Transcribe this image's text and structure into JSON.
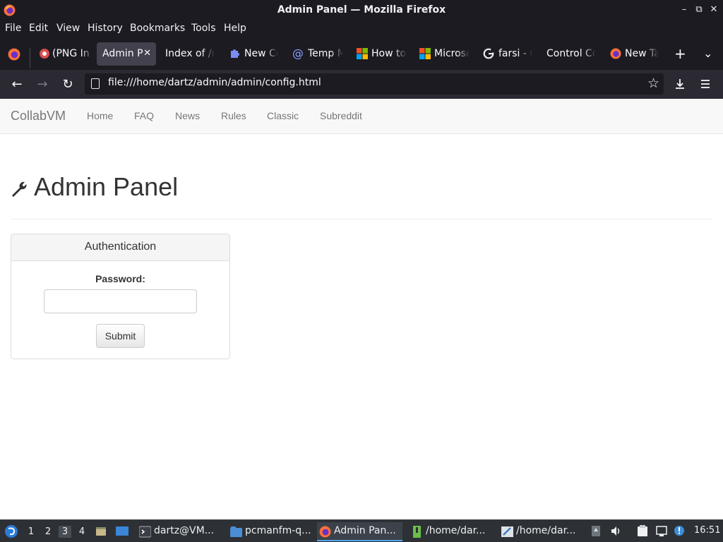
{
  "window": {
    "title": "Admin Panel — Mozilla Firefox"
  },
  "menubar": [
    "File",
    "Edit",
    "View",
    "History",
    "Bookmarks",
    "Tools",
    "Help"
  ],
  "tabs": [
    {
      "label": "(PNG In",
      "icon": "red-circle-icon"
    },
    {
      "label": "Admin P",
      "icon": "",
      "active": true
    },
    {
      "label": "Index of /r",
      "icon": ""
    },
    {
      "label": "New Co",
      "icon": "puzzle-icon"
    },
    {
      "label": "Temp M",
      "icon": "at-sign-icon"
    },
    {
      "label": "How to",
      "icon": "microsoft-icon"
    },
    {
      "label": "Microso",
      "icon": "microsoft-icon"
    },
    {
      "label": "farsi - G",
      "icon": "google-icon"
    },
    {
      "label": "Control Co",
      "icon": ""
    },
    {
      "label": "New Ta",
      "icon": "firefox-icon"
    }
  ],
  "navbar": {
    "url": "file:///home/dartz/admin/admin/config.html"
  },
  "site": {
    "brand": "CollabVM",
    "links": [
      "Home",
      "FAQ",
      "News",
      "Rules",
      "Classic",
      "Subreddit"
    ],
    "heading": "Admin Panel",
    "panel_title": "Authentication",
    "password_label": "Password:",
    "password_value": "",
    "submit_label": "Submit"
  },
  "taskbar": {
    "workspaces": [
      "1",
      "2",
      "3",
      "4"
    ],
    "active_workspace": "3",
    "tasks": [
      {
        "label": "dartz@VM...",
        "icon": "terminal-icon"
      },
      {
        "label": "pcmanfm-q...",
        "icon": "folder-icon"
      },
      {
        "label": "Admin Pan...",
        "icon": "firefox-icon",
        "active": true
      },
      {
        "label": "/home/dar...",
        "icon": "archive-icon"
      },
      {
        "label": "/home/dar...",
        "icon": "text-editor-icon"
      }
    ],
    "clock": "16:51"
  },
  "colors": {
    "browser_chrome": "#1c1b22",
    "navbar": "#2b2a33",
    "active_tab": "#42414d",
    "site_nav": "#f8f8f8",
    "taskbar": "#2d3136",
    "taskbar_accent": "#4ea4e6"
  }
}
